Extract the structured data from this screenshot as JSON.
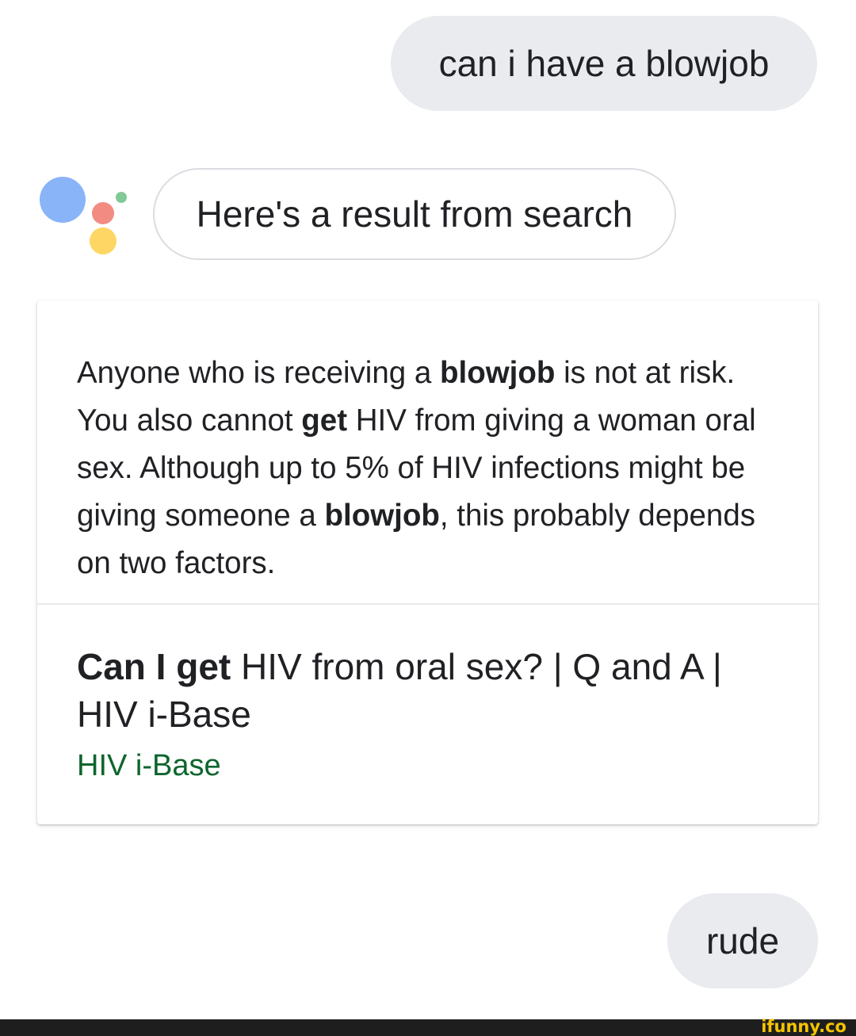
{
  "conversation": {
    "user_message_1": "can i have a blowjob",
    "assistant_reply": "Here's a result from search",
    "user_message_2": "rude"
  },
  "assistant_logo": {
    "icon": "google-assistant-icon",
    "colors": [
      "#8ab4f8",
      "#f28b82",
      "#fdd663",
      "#81c995"
    ]
  },
  "result_card": {
    "snippet": {
      "s1": "Anyone who is receiving a ",
      "b1": "blowjob",
      "s2": " is not at risk. You also cannot ",
      "b2": "get",
      "s3": " HIV from giving a woman oral sex. Although up to 5% of HIV infections might be giving someone a ",
      "b3": "blowjob",
      "s4": ", this probably depends on two factors."
    },
    "source_title": {
      "bold": "Can I get",
      "rest": " HIV from oral sex? | Q and A | HIV i-Base"
    },
    "source_site": "HIV i-Base",
    "source_site_color": "#0d652d"
  },
  "watermark": "ifunny.co"
}
